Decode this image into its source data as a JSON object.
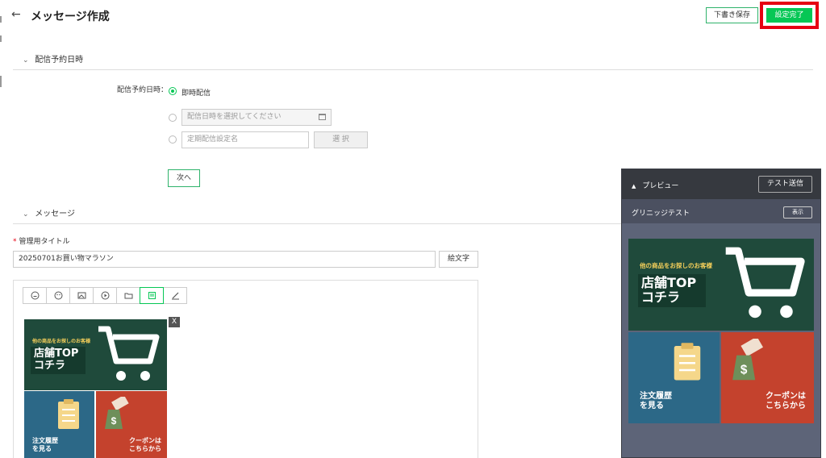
{
  "header": {
    "back_icon": "arrow-left-icon",
    "title": "メッセージ作成",
    "draft_label": "下書き保存",
    "done_label": "設定完了",
    "highlight_color": "#e60012",
    "accent_color": "#06c755"
  },
  "schedule": {
    "section_title": "配信予約日時",
    "field_label": "配信予約日時：",
    "options": [
      {
        "label": "即時配信",
        "selected": true
      },
      {
        "placeholder": "配信日時を選択してください",
        "selected": false
      },
      {
        "placeholder": "定期配信設定名",
        "selected": false
      }
    ],
    "select_label": "選 択",
    "next_label": "次へ"
  },
  "message": {
    "section_title": "メッセージ",
    "title_label": "管理用タイトル",
    "title_value": "20250701お買い物マラソン",
    "emoji_label": "絵文字",
    "toolbar_icons": [
      "sticker-icon",
      "emoji-icon",
      "image-icon",
      "video-icon",
      "folder-icon",
      "richmessage-icon",
      "edit-icon"
    ],
    "close_label": "X"
  },
  "richmenu": {
    "top_small": "他の商品をお探しのお客様",
    "top_big_1": "店舗TOP",
    "top_big_2": "コチラ",
    "left_1": "注文履歴",
    "left_2": "を見る",
    "right_1": "クーポンは",
    "right_2": "こちらから"
  },
  "preview": {
    "title": "プレビュー",
    "test_send_label": "テスト送信",
    "chat_name": "グリニッジテスト",
    "show_label": "表示"
  }
}
